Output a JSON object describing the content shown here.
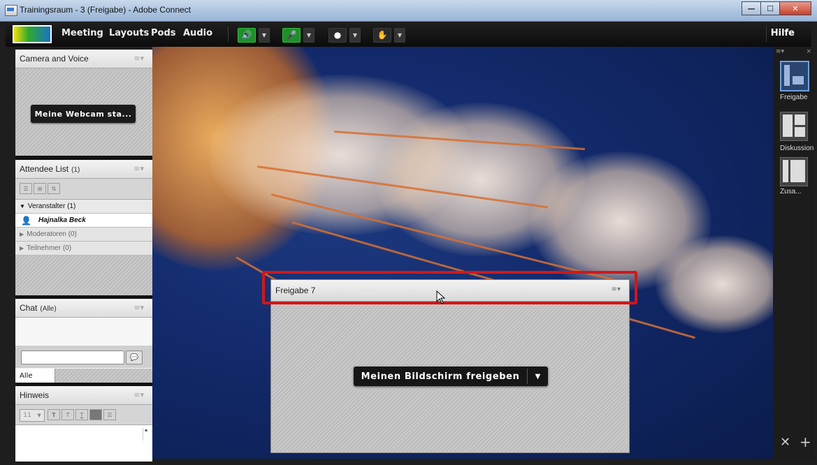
{
  "window": {
    "title": "Trainingsraum - 3 (Freigabe) - Adobe Connect"
  },
  "menubar": {
    "items": [
      "Meeting",
      "Layouts",
      "Pods",
      "Audio"
    ],
    "help": "Hilfe"
  },
  "camera_pod": {
    "title": "Camera and Voice",
    "button": "Meine Webcam sta..."
  },
  "attendee_pod": {
    "title": "Attendee List",
    "count": "(1)",
    "groups": [
      {
        "label": "Veranstalter (1)",
        "expanded": true,
        "members": [
          "Hajnalka Beck"
        ]
      },
      {
        "label": "Moderatoren (0)",
        "expanded": false,
        "members": []
      },
      {
        "label": "Teilnehmer (0)",
        "expanded": false,
        "members": []
      }
    ]
  },
  "chat_pod": {
    "title": "Chat",
    "scope": "(Alle)",
    "recipient": "Alle"
  },
  "notes_pod": {
    "title": "Hinweis",
    "font_size": "11"
  },
  "share_pod": {
    "title": "Freigabe 7",
    "button": "Meinen Bildschirm freigeben"
  },
  "layouts": [
    "Freigabe",
    "Diskussion",
    "Zusa..."
  ],
  "colors": {
    "highlight": "#d0181b",
    "mic_active": "#1f8f2b",
    "menubar": "#111111"
  }
}
